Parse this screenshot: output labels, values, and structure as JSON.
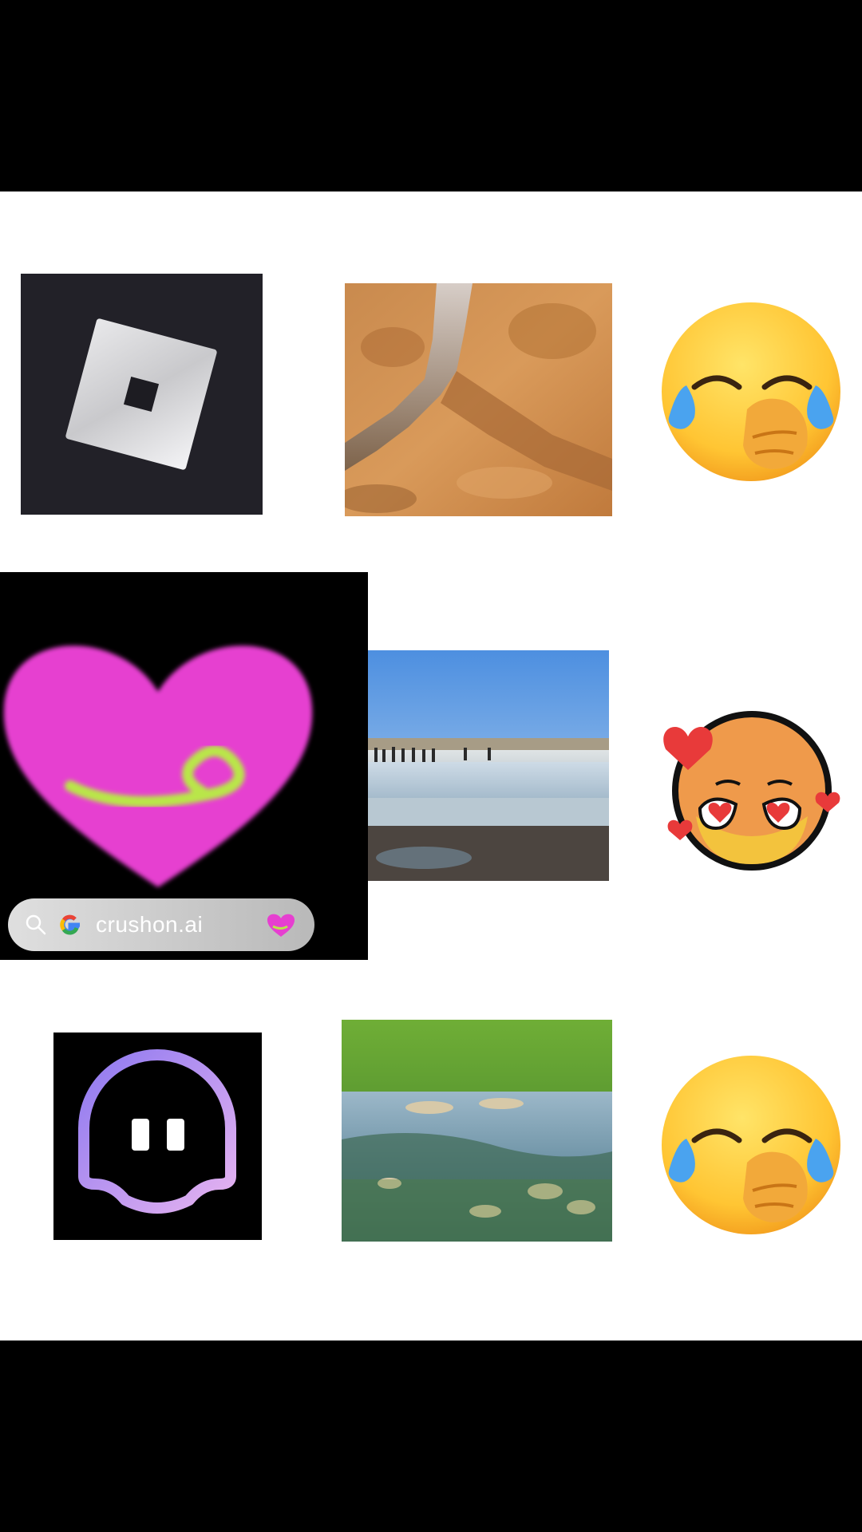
{
  "grid": {
    "rows": [
      {
        "items": [
          {
            "name": "roblox-logo",
            "kind": "app-logo"
          },
          {
            "name": "desert-stream-photo",
            "kind": "photo"
          },
          {
            "name": "laughing-tears-emoji",
            "kind": "emoji"
          }
        ]
      },
      {
        "items": [
          {
            "name": "crushon-heart-logo",
            "kind": "app-logo"
          },
          {
            "name": "geyser-photo",
            "kind": "photo"
          },
          {
            "name": "heart-eyes-blush-emoji",
            "kind": "emoji"
          }
        ]
      },
      {
        "items": [
          {
            "name": "ghost-chat-logo",
            "kind": "app-logo"
          },
          {
            "name": "forest-river-photo",
            "kind": "photo"
          },
          {
            "name": "laughing-tears-emoji",
            "kind": "emoji"
          }
        ]
      }
    ]
  },
  "search_pill": {
    "query": "crushon.ai",
    "icons": [
      "search-icon",
      "google-g-icon",
      "heart-icon"
    ]
  },
  "colors": {
    "letterbox": "#000000",
    "background": "#ffffff",
    "crushon_pink": "#e63fd0",
    "crushon_green": "#b9e64a",
    "ghost_purple": "#b9a2f5"
  }
}
